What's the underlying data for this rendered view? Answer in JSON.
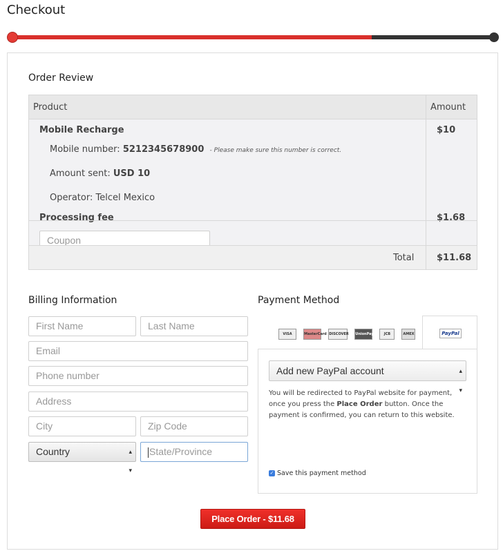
{
  "page": {
    "title": "Checkout"
  },
  "progress": {
    "fraction": 0.745
  },
  "order_review": {
    "title": "Order Review",
    "columns": {
      "product": "Product",
      "amount": "Amount"
    },
    "item": {
      "name": "Mobile Recharge",
      "amount": "$10",
      "mobile_label": "Mobile number:",
      "mobile_value": "5212345678900",
      "mobile_note": "- Please make sure this number is correct.",
      "amount_sent_label": "Amount sent:",
      "amount_sent_value": "USD 10",
      "operator": "Operator: Telcel Mexico"
    },
    "fee": {
      "label": "Processing fee",
      "amount": "$1.68"
    },
    "coupon": {
      "placeholder": "Coupon"
    },
    "total": {
      "label": "Total",
      "amount": "$11.68"
    }
  },
  "billing": {
    "title": "Billing Information",
    "first_name": "First Name",
    "last_name": "Last Name",
    "email": "Email",
    "phone": "Phone number",
    "address": "Address",
    "city": "City",
    "zip": "Zip Code",
    "country": "Country",
    "state": "State/Province"
  },
  "payment": {
    "title": "Payment Method",
    "cards": [
      "VISA",
      "MasterCard",
      "DISCOVER",
      "UnionPay",
      "JCB",
      "AMEX"
    ],
    "paypal_tab": "PayPal",
    "account_select": "Add new PayPal account",
    "note_before": "You will be redirected to PayPal website for payment, once you press the ",
    "note_bold": "Place Order",
    "note_after": " button. Once the payment is confirmed, you can return to this website.",
    "save_label": "Save this payment method"
  },
  "place_order": {
    "label": "Place Order - $11.68"
  },
  "colors": {
    "accent": "#d9302c",
    "track": "#333333",
    "focus": "#7aa6d6",
    "checkbox": "#3b7ddd"
  }
}
